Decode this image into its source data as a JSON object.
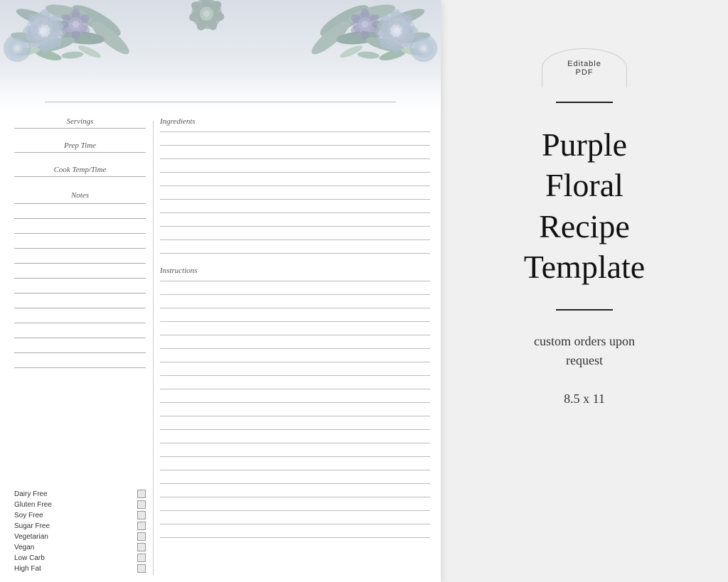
{
  "badge": {
    "line1": "Editable",
    "line2": "PDF"
  },
  "recipe_card": {
    "fields": {
      "servings_label": "Servings",
      "prep_time_label": "Prep Time",
      "cook_temp_label": "Cook Temp/Time",
      "notes_label": "Notes"
    },
    "sections": {
      "ingredients_label": "Ingredients",
      "instructions_label": "Instructions"
    },
    "checkboxes": [
      "Dairy Free",
      "Gluten Free",
      "Soy Free",
      "Sugar Free",
      "Vegetarian",
      "Vegan",
      "Low Carb",
      "High Fat"
    ]
  },
  "title_area": {
    "main_title_line1": "Purple",
    "main_title_line2": "Floral",
    "main_title_line3": "Recipe",
    "main_title_line4": "Template",
    "subtitle": "custom orders upon\nrequest",
    "size": "8.5 x 11"
  }
}
